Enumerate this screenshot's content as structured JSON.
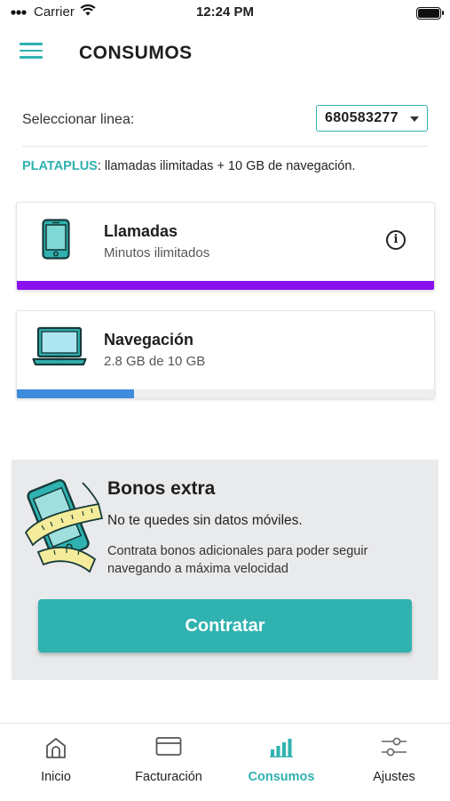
{
  "status_bar": {
    "carrier": "Carrier",
    "time": "12:24 PM"
  },
  "header": {
    "title": "CONSUMOS"
  },
  "line_selector": {
    "label": "Seleccionar linea:",
    "selected": "680583277"
  },
  "plan": {
    "name": "PLATAPLUS",
    "description": ": llamadas ilimitadas + 10 GB de navegación."
  },
  "cards": [
    {
      "title": "Llamadas",
      "subtitle": "Minutos ilimitados",
      "usage_fraction": 1.0,
      "bar_color": "#8a10f0"
    },
    {
      "title": "Navegación",
      "subtitle": "2.8 GB de 10 GB",
      "usage_fraction": 0.28,
      "bar_color": "#3f8bdc"
    }
  ],
  "bonos": {
    "title": "Bonos extra",
    "text1": "No te quedes sin datos móviles.",
    "text2": "Contrata bonos adicionales para poder seguir navegando a máxima velocidad",
    "cta": "Contratar"
  },
  "tabs": [
    {
      "label": "Inicio",
      "icon": "home-icon"
    },
    {
      "label": "Facturación",
      "icon": "card-icon"
    },
    {
      "label": "Consumos",
      "icon": "signal-bars-icon",
      "active": true
    },
    {
      "label": "Ajustes",
      "icon": "sliders-icon"
    }
  ],
  "colors": {
    "accent": "#2fb2b0",
    "panel": "#e9eaec"
  }
}
